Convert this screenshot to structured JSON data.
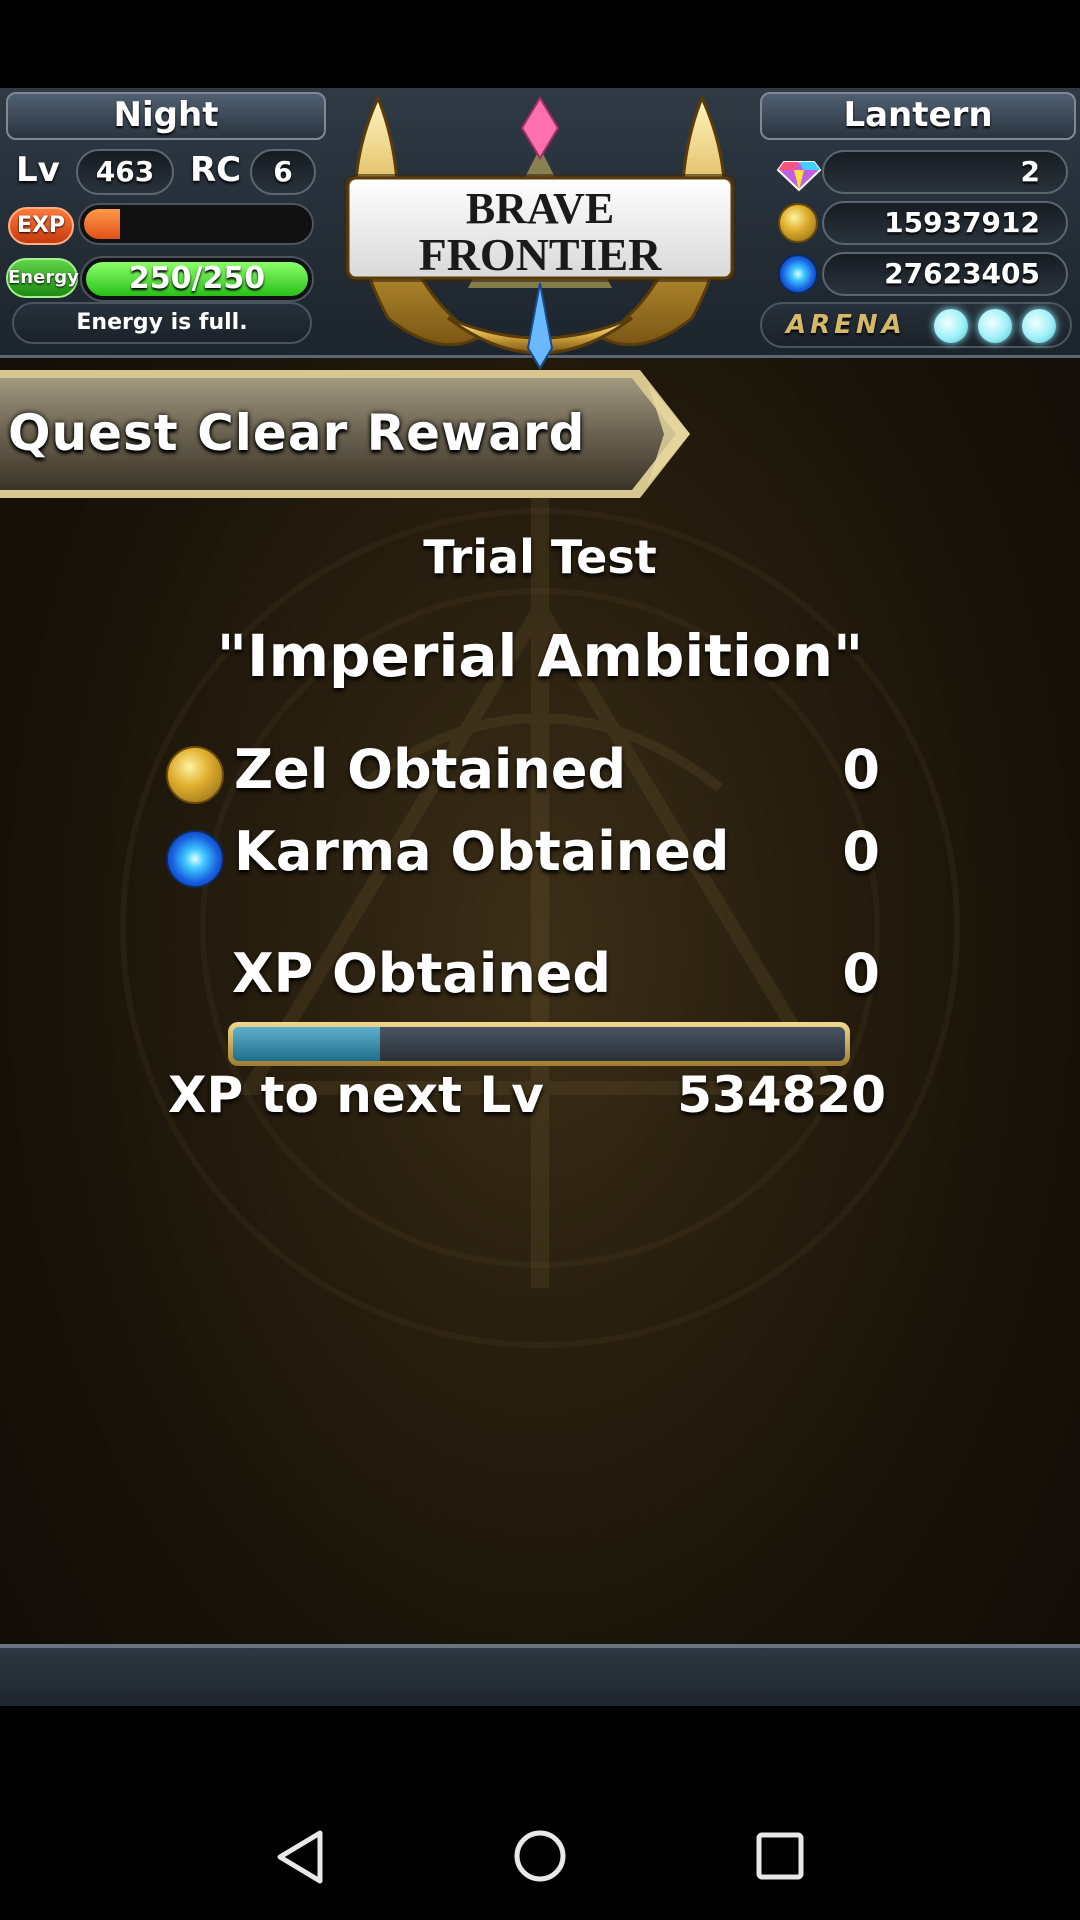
{
  "hud": {
    "player_name": "Night",
    "lv_label": "Lv",
    "level": "463",
    "rc_label": "RC",
    "rc_value": "6",
    "exp_label": "EXP",
    "exp_progress_fraction": 0.16,
    "energy_label": "Energy",
    "energy_value": "250/250",
    "energy_fraction": 1.0,
    "energy_status": "Energy is full.",
    "friend_name": "Lantern",
    "gems": "2",
    "zel": "15937912",
    "karma": "27623405",
    "arena_label": "ARENA",
    "arena_orbs": 3
  },
  "logo": {
    "line1": "BRAVE",
    "line2": "FRONTIER"
  },
  "banner": {
    "title": "Quest Clear Reward"
  },
  "quest": {
    "category": "Trial Test",
    "name": "\"Imperial Ambition\""
  },
  "rewards": {
    "zel_label": "Zel Obtained",
    "zel_value": "0",
    "karma_label": "Karma Obtained",
    "karma_value": "0",
    "xp_label": "XP Obtained",
    "xp_value": "0",
    "xp_progress_fraction": 0.24,
    "next_lv_label": "XP to next Lv",
    "next_lv_value": "534820"
  },
  "icons": [
    "gem-icon",
    "zel-coin-icon",
    "karma-orb-icon",
    "back-icon",
    "home-icon",
    "recents-icon"
  ],
  "colors": {
    "exp": "#e0501a",
    "energy": "#28c018",
    "xp_bar": "#1f6e8c",
    "arena": "#d6b86a"
  }
}
